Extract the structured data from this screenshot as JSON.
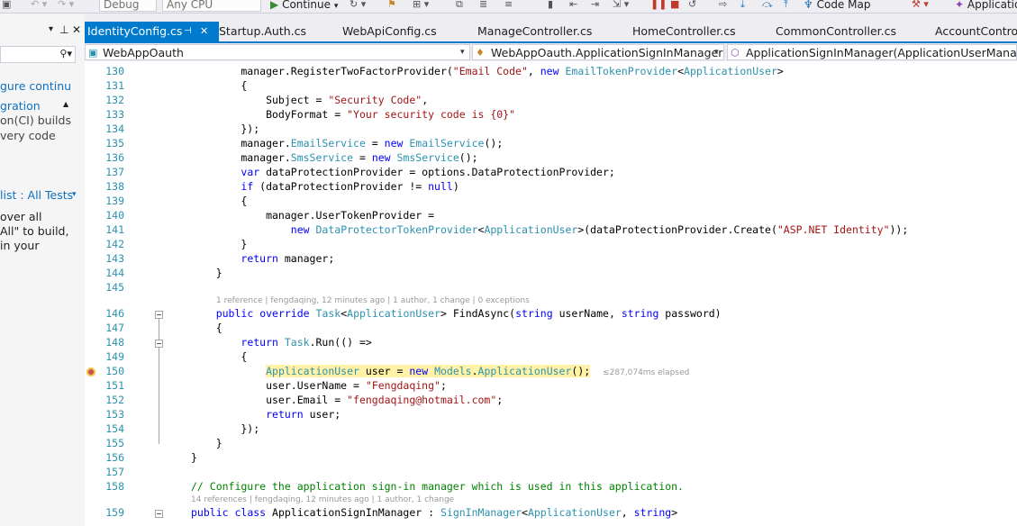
{
  "toolbar": {
    "config": "Debug",
    "platform": "Any CPU",
    "continue_label": "Continue",
    "code_map_label": "Code Map",
    "app_insights_label": "Applicatio"
  },
  "left_panel": {
    "lines": [
      {
        "text": "gure continu",
        "color": "#0e70c0"
      },
      {
        "text": "gration",
        "color": "#0e70c0"
      },
      {
        "text": "on(CI) builds",
        "color": "#444444"
      },
      {
        "text": "very code",
        "color": "#444444"
      },
      {
        "text": "list : All Tests",
        "color": "#0e70c0"
      },
      {
        "text": "over all",
        "color": "#1e1e1e"
      },
      {
        "text": "All\" to build,",
        "color": "#1e1e1e"
      },
      {
        "text": "in your",
        "color": "#1e1e1e"
      }
    ]
  },
  "tabs": [
    {
      "label": "IdentityConfig.cs",
      "active": true
    },
    {
      "label": "Startup.Auth.cs",
      "active": false
    },
    {
      "label": "WebApiConfig.cs",
      "active": false
    },
    {
      "label": "ManageController.cs",
      "active": false
    },
    {
      "label": "HomeController.cs",
      "active": false
    },
    {
      "label": "CommonController.cs",
      "active": false
    },
    {
      "label": "AccountControll",
      "active": false
    }
  ],
  "nav": {
    "project": "WebAppOauth",
    "type": "WebAppOauth.ApplicationSignInManager",
    "member": "ApplicationSignInManager(ApplicationUserManager"
  },
  "editor": {
    "codelens_1": "1 reference | fengdaqing, 12 minutes ago | 1 author, 1 change | 0 exceptions",
    "codelens_2": "14 references | fengdaqing, 12 minutes ago | 1 author, 1 change",
    "elapsed": "≤287,074ms elapsed",
    "lines": [
      {
        "n": "130",
        "code": "        manager.RegisterTwoFactorProvider(\"Email Code\", new EmailTokenProvider<ApplicationUser>"
      },
      {
        "n": "131",
        "code": "        {"
      },
      {
        "n": "132",
        "code": "            Subject = \"Security Code\","
      },
      {
        "n": "133",
        "code": "            BodyFormat = \"Your security code is {0}\""
      },
      {
        "n": "134",
        "code": "        });"
      },
      {
        "n": "135",
        "code": "        manager.EmailService = new EmailService();"
      },
      {
        "n": "136",
        "code": "        manager.SmsService = new SmsService();"
      },
      {
        "n": "137",
        "code": "        var dataProtectionProvider = options.DataProtectionProvider;"
      },
      {
        "n": "138",
        "code": "        if (dataProtectionProvider != null)"
      },
      {
        "n": "139",
        "code": "        {"
      },
      {
        "n": "140",
        "code": "            manager.UserTokenProvider ="
      },
      {
        "n": "141",
        "code": "                new DataProtectorTokenProvider<ApplicationUser>(dataProtectionProvider.Create(\"ASP.NET Identity\"));"
      },
      {
        "n": "142",
        "code": "        }"
      },
      {
        "n": "143",
        "code": "        return manager;"
      },
      {
        "n": "144",
        "code": "    }"
      },
      {
        "n": "145",
        "code": ""
      },
      {
        "n": "146",
        "code": "    public override Task<ApplicationUser> FindAsync(string userName, string password)"
      },
      {
        "n": "147",
        "code": "    {"
      },
      {
        "n": "148",
        "code": "        return Task.Run(() =>"
      },
      {
        "n": "149",
        "code": "        {"
      },
      {
        "n": "150",
        "code": "            ApplicationUser user = new Models.ApplicationUser();"
      },
      {
        "n": "151",
        "code": "            user.UserName = \"Fengdaqing\";"
      },
      {
        "n": "152",
        "code": "            user.Email = \"fengdaqing@hotmail.com\";"
      },
      {
        "n": "153",
        "code": "            return user;"
      },
      {
        "n": "154",
        "code": "        });"
      },
      {
        "n": "155",
        "code": "    }"
      },
      {
        "n": "156",
        "code": "}"
      },
      {
        "n": "157",
        "code": ""
      },
      {
        "n": "158",
        "code": "// Configure the application sign-in manager which is used in this application."
      },
      {
        "n": "159",
        "code": "public class ApplicationSignInManager : SignInManager<ApplicationUser, string>"
      }
    ]
  },
  "colors": {
    "accent": "#007acc",
    "keyword": "#0000ff",
    "type": "#2b91af",
    "string": "#a31515",
    "comment": "#008000",
    "highlight": "#fff2a6"
  }
}
